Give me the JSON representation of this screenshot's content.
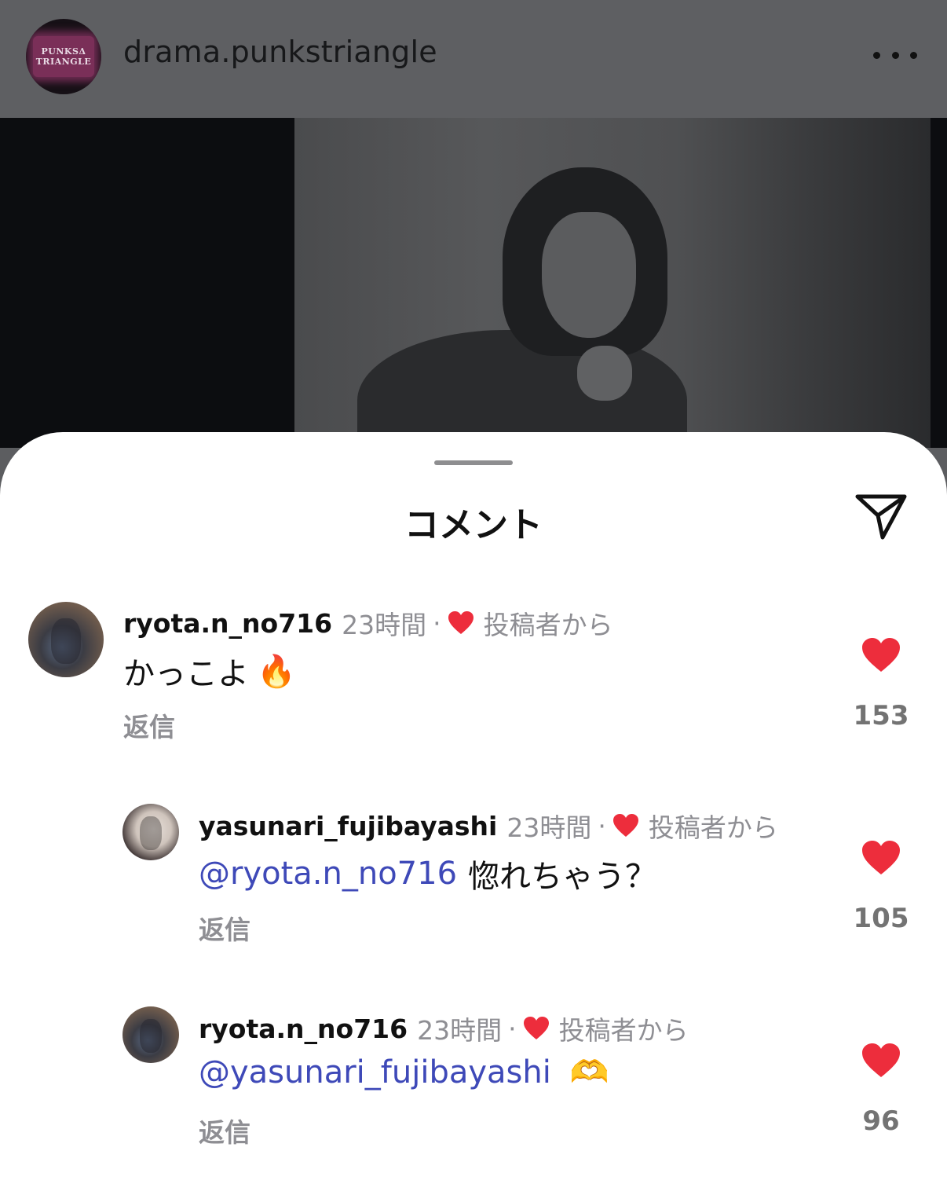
{
  "header": {
    "username": "drama.punkstriangle",
    "logo_text_line1": "PUNKSΔ",
    "logo_text_line2": "TRIANGLE"
  },
  "sheet": {
    "title": "コメント"
  },
  "comments": [
    {
      "username": "ryota.n_no716",
      "time": "23時間",
      "separator": "·",
      "author_badge": "投稿者から",
      "mention": "",
      "text": "かっこよ",
      "emoji": "🔥",
      "reply_label": "返信",
      "likes": "153"
    },
    {
      "username": "yasunari_fujibayashi",
      "time": "23時間",
      "separator": "·",
      "author_badge": "投稿者から",
      "mention": "@ryota.n_no716",
      "text": "惚れちゃう？",
      "emoji": "",
      "reply_label": "返信",
      "likes": "105"
    },
    {
      "username": "ryota.n_no716",
      "time": "23時間",
      "separator": "·",
      "author_badge": "投稿者から",
      "mention": "@yasunari_fujibayashi",
      "text": "",
      "emoji": "🫶",
      "reply_label": "返信",
      "likes": "96"
    }
  ],
  "colors": {
    "like_red": "#ed2d3c",
    "mention_blue": "#3e49b8",
    "muted_gray": "#8e8e93"
  },
  "icons": {
    "more": "more-horizontal-icon",
    "share": "paper-plane-icon",
    "like": "heart-icon"
  }
}
